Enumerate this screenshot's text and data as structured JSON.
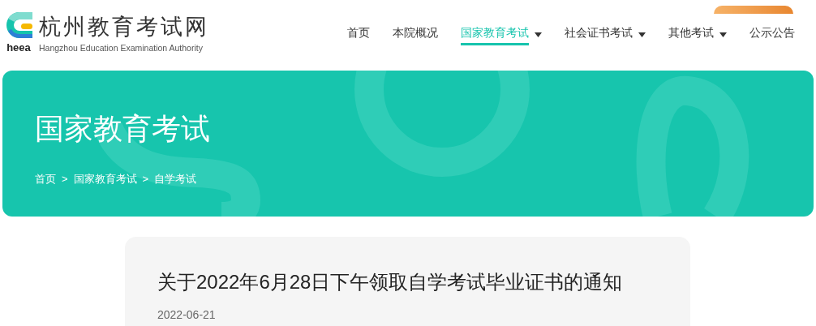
{
  "logo": {
    "mark_text": "heea",
    "title": "杭州教育考试网",
    "subtitle": "Hangzhou Education Examination Authority"
  },
  "nav": [
    {
      "label": "首页",
      "selected": false,
      "dropdown": false
    },
    {
      "label": "本院概况",
      "selected": false,
      "dropdown": false
    },
    {
      "label": "国家教育考试",
      "selected": true,
      "dropdown": true
    },
    {
      "label": "社会证书考试",
      "selected": false,
      "dropdown": true
    },
    {
      "label": "其他考试",
      "selected": false,
      "dropdown": true
    },
    {
      "label": "公示公告",
      "selected": false,
      "dropdown": false
    }
  ],
  "banner": {
    "title": "国家教育考试",
    "breadcrumb": [
      {
        "label": "首页"
      },
      {
        "label": "国家教育考试"
      },
      {
        "label": "自学考试"
      }
    ],
    "separator": ">"
  },
  "article": {
    "title": "关于2022年6月28日下午领取自学考试毕业证书的通知",
    "date": "2022-06-21"
  }
}
